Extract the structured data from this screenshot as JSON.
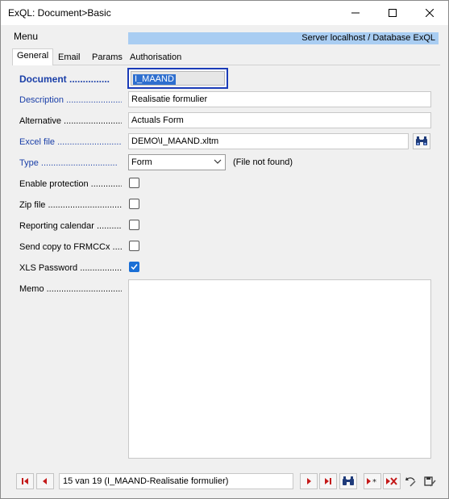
{
  "window": {
    "title": "ExQL: Document>Basic"
  },
  "menu": {
    "label": "Menu",
    "server_info": "Server localhost / Database ExQL"
  },
  "tabs": [
    {
      "label": "General",
      "active": true
    },
    {
      "label": "Email",
      "active": false
    },
    {
      "label": "Params",
      "active": false
    },
    {
      "label": "Authorisation",
      "active": false
    }
  ],
  "form": {
    "document": {
      "label": "Document ...............",
      "value": "I_MAAND"
    },
    "description": {
      "label": "Description ...............................",
      "value": "Realisatie formulier"
    },
    "alternative": {
      "label": "Alternative ...............................",
      "value": "Actuals Form"
    },
    "excel_file": {
      "label": "Excel file ...............................",
      "value": "DEMO\\I_MAAND.xltm"
    },
    "type": {
      "label": "Type ...............................",
      "value": "Form",
      "note": "(File not found)"
    },
    "enable_protection": {
      "label": "Enable protection ..............",
      "checked": false
    },
    "zip_file": {
      "label": "Zip file ...............................",
      "checked": false
    },
    "reporting_calendar": {
      "label": "Reporting calendar ..........",
      "checked": false
    },
    "send_copy": {
      "label": "Send copy to FRMCCx ....",
      "checked": false
    },
    "xls_password": {
      "label": "XLS Password ..................",
      "checked": true
    },
    "memo": {
      "label": "Memo ...............................",
      "value": ""
    }
  },
  "navigation": {
    "record_text": "15 van 19 (I_MAAND-Realisatie formulier)"
  },
  "colors": {
    "accent": "#1a3fa8",
    "banner": "#a9cdf2",
    "nav_red": "#c41a1a",
    "check_blue": "#1a6fd6"
  }
}
